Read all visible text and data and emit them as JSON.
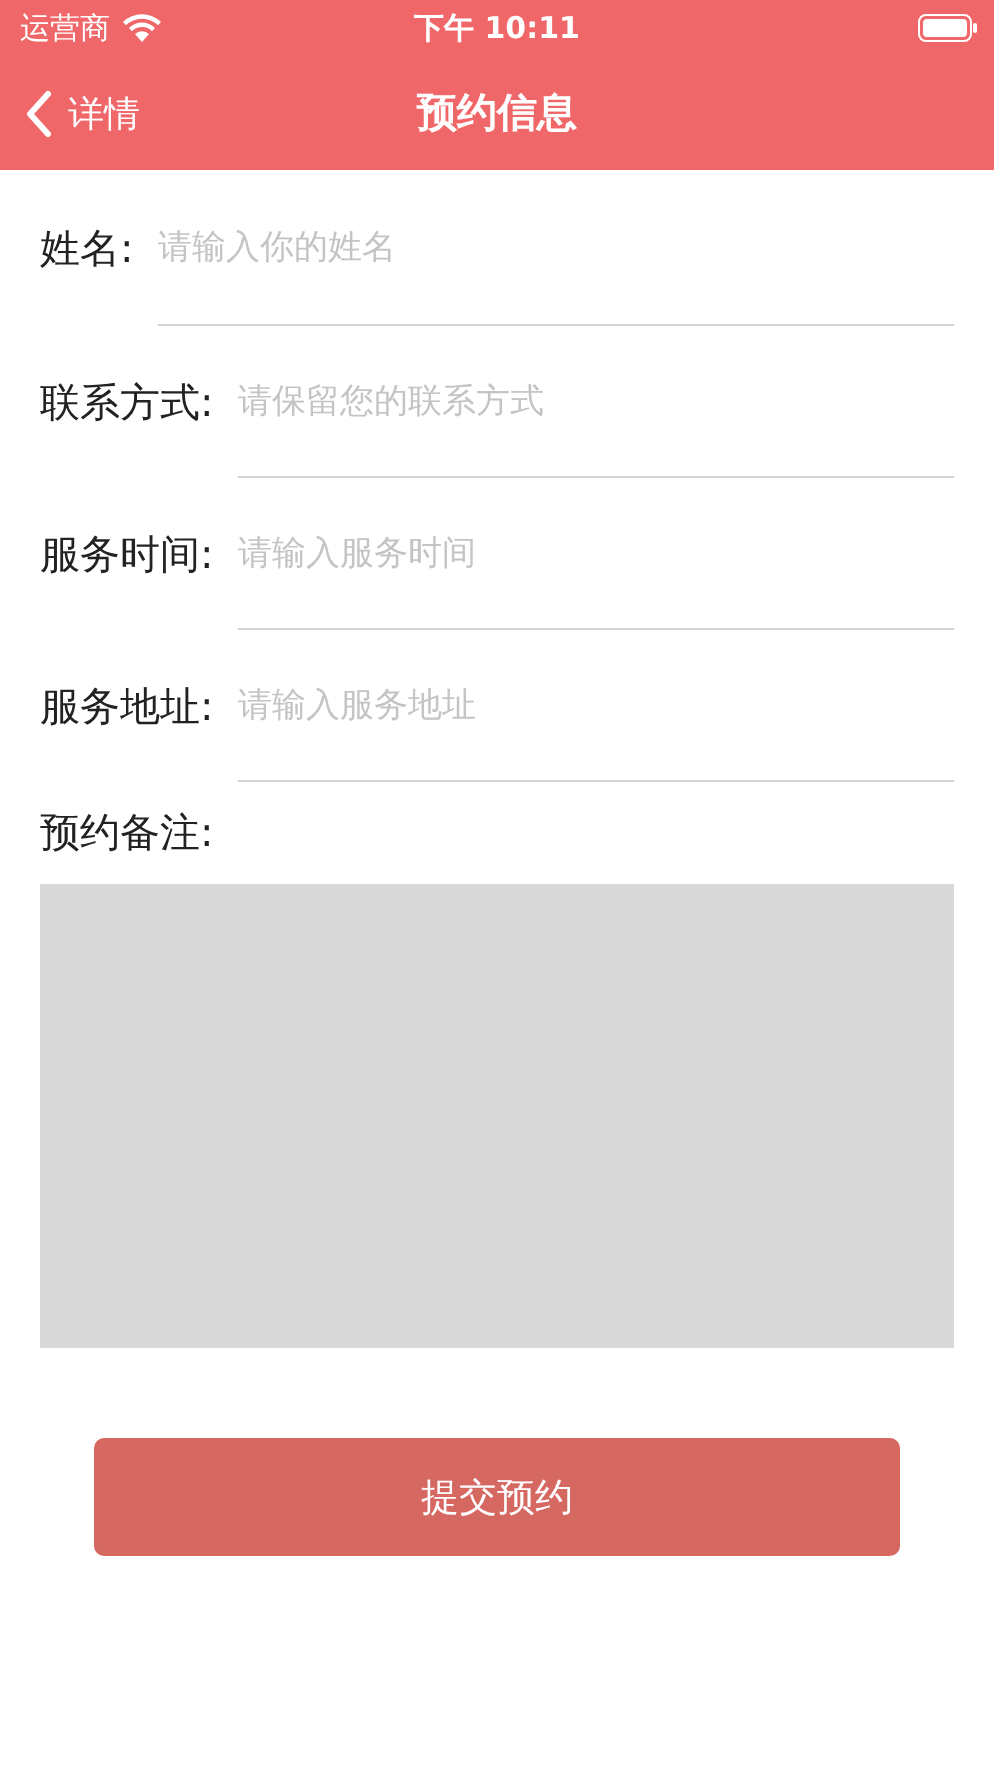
{
  "status_bar": {
    "carrier": "运营商",
    "time": "下午 10:11"
  },
  "nav": {
    "back": "详情",
    "title": "预约信息"
  },
  "fields": [
    {
      "label": "姓名:",
      "placeholder": "请输入你的姓名"
    },
    {
      "label": "联系方式:",
      "placeholder": "请保留您的联系方式"
    },
    {
      "label": "服务时间:",
      "placeholder": "请输入服务时间"
    },
    {
      "label": "服务地址:",
      "placeholder": "请输入服务地址"
    }
  ],
  "note": {
    "label": "预约备注:"
  },
  "submit": "提交预约"
}
